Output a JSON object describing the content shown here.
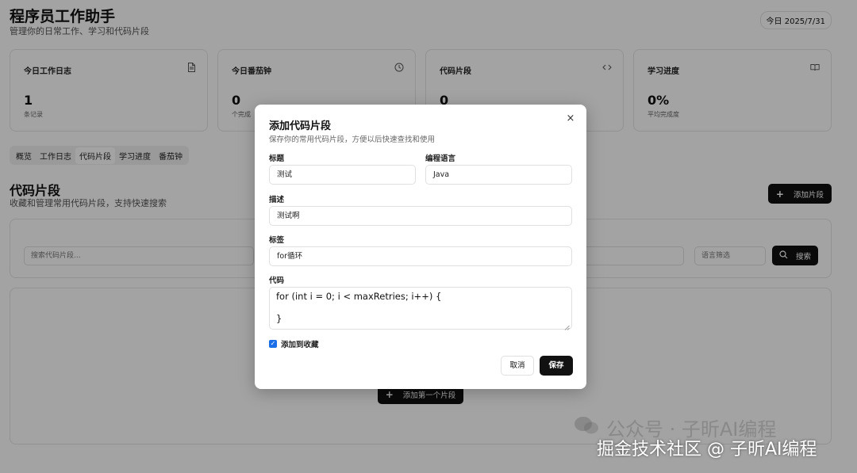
{
  "header": {
    "title": "程序员工作助手",
    "subtitle": "管理你的日常工作、学习和代码片段",
    "date_badge": "今日 2025/7/31"
  },
  "stats": [
    {
      "title": "今日工作日志",
      "icon": "document-icon",
      "value": "1",
      "sub": "条记录"
    },
    {
      "title": "今日番茄钟",
      "icon": "clock-icon",
      "value": "0",
      "sub": "个完成"
    },
    {
      "title": "代码片段",
      "icon": "code-icon",
      "value": "0",
      "sub": ""
    },
    {
      "title": "学习进度",
      "icon": "book-icon",
      "value": "0%",
      "sub": "平均完成度"
    }
  ],
  "tabs": [
    {
      "label": "概览",
      "active": false
    },
    {
      "label": "工作日志",
      "active": false
    },
    {
      "label": "代码片段",
      "active": true
    },
    {
      "label": "学习进度",
      "active": false
    },
    {
      "label": "番茄钟",
      "active": false
    }
  ],
  "section": {
    "title": "代码片段",
    "subtitle": "收藏和管理常用代码片段，支持快速搜索",
    "add_button": "添加片段"
  },
  "search": {
    "placeholder": "搜索代码片段...",
    "language_filter": "语言筛选",
    "button": "搜索"
  },
  "empty": {
    "add_first": "添加第一个片段"
  },
  "modal": {
    "title": "添加代码片段",
    "description": "保存你的常用代码片段，方便以后快速查找和使用",
    "title_label": "标题",
    "title_value": "测试",
    "language_label": "编程语言",
    "language_value": "Java",
    "description_label": "描述",
    "description_value": "测试啊",
    "tags_label": "标签",
    "tags_value": "for循环",
    "code_label": "代码",
    "code_lines": [
      "for (int i = 0; i < maxRetries; i++) {",
      "",
      "}"
    ],
    "favorite_label": "添加到收藏",
    "favorite_checked": true,
    "cancel": "取消",
    "save": "保存"
  },
  "watermark": {
    "faint": "公众号 · 子昕AI编程",
    "main": "掘金技术社区 @ 子昕AI编程"
  },
  "colors": {
    "primary": "#111111",
    "checkbox": "#1a6fe8",
    "overlay": "rgba(0,0,0,0.36)"
  }
}
